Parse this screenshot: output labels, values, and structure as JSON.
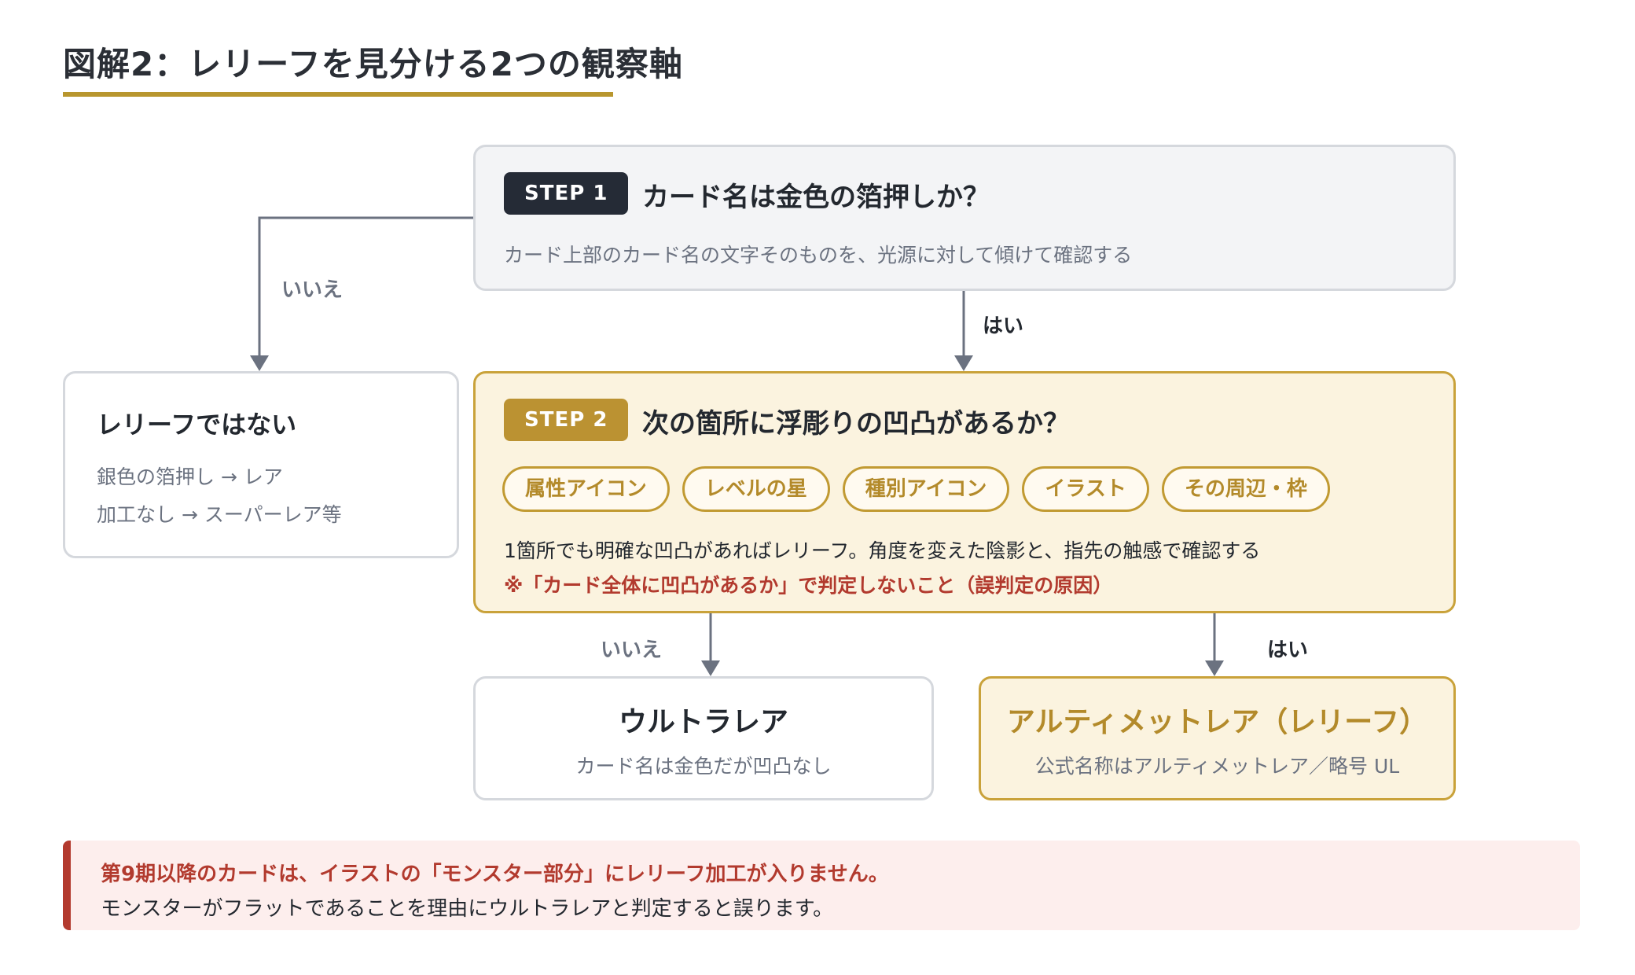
{
  "title": "図解2：レリーフを見分ける2つの観察軸",
  "colors": {
    "accent_gold": "#b8962e",
    "dark_badge": "#252b36",
    "warning_red": "#b23a2e",
    "gold_fill": "#fbf3df"
  },
  "step1": {
    "badge": "STEP 1",
    "question": "カード名は金色の箔押しか？",
    "description": "カード上部のカード名の文字そのものを、光源に対して傾けて確認する"
  },
  "step2": {
    "badge": "STEP 2",
    "question": "次の箇所に浮彫りの凹凸があるか？",
    "chips": [
      "属性アイコン",
      "レベルの星",
      "種別アイコン",
      "イラスト",
      "その周辺・枠"
    ],
    "note": "1箇所でも明確な凹凸があればレリーフ。角度を変えた陰影と、指先の触感で確認する",
    "warning": "※「カード全体に凹凸があるか」で判定しないこと（誤判定の原因）"
  },
  "not_relief": {
    "title": "レリーフではない",
    "lines": [
      "銀色の箔押し → レア",
      "加工なし → スーパーレア等"
    ]
  },
  "ultra_rare": {
    "title": "ウルトラレア",
    "subtitle": "カード名は金色だが凹凸なし"
  },
  "ultimate_rare": {
    "title": "アルティメットレア（レリーフ）",
    "subtitle": "公式名称はアルティメットレア／略号 UL"
  },
  "edges": {
    "step1_no": "いいえ",
    "step1_yes": "はい",
    "step2_no": "いいえ",
    "step2_yes": "はい"
  },
  "warning_box": {
    "line1": "第9期以降のカードは、イラストの「モンスター部分」にレリーフ加工が入りません。",
    "line2": "モンスターがフラットであることを理由にウルトラレアと判定すると誤ります。"
  }
}
